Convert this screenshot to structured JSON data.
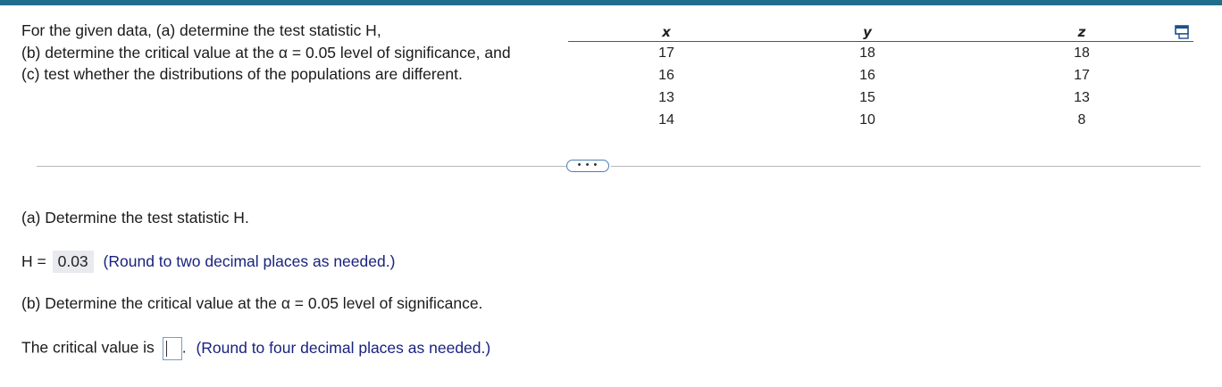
{
  "question": {
    "lines": [
      "For the given data, (a) determine the test statistic H,",
      "(b) determine the critical value at the α = 0.05 level of significance, and",
      "(c) test whether the distributions of the populations are different."
    ]
  },
  "table": {
    "headers": [
      "x",
      "y",
      "z"
    ],
    "rows": [
      [
        "17",
        "18",
        "18"
      ],
      [
        "16",
        "16",
        "17"
      ],
      [
        "13",
        "15",
        "13"
      ],
      [
        "14",
        "10",
        "8"
      ]
    ]
  },
  "more_button": "• • •",
  "part_a": {
    "heading": "(a) Determine the test statistic H.",
    "label": "H =",
    "value": "0.03",
    "hint": "(Round to two decimal places as needed.)"
  },
  "part_b": {
    "heading": "(b) Determine the critical value at the α = 0.05 level of significance.",
    "label": "The critical value is",
    "input_value": "",
    "period": ".",
    "hint": "(Round to four decimal places as needed.)"
  },
  "icons": {
    "popout": "popout-window-icon"
  },
  "colors": {
    "top_bar": "#1f6e8c",
    "hint_text": "#1a237e",
    "answer_bg": "#e8eaf0"
  }
}
